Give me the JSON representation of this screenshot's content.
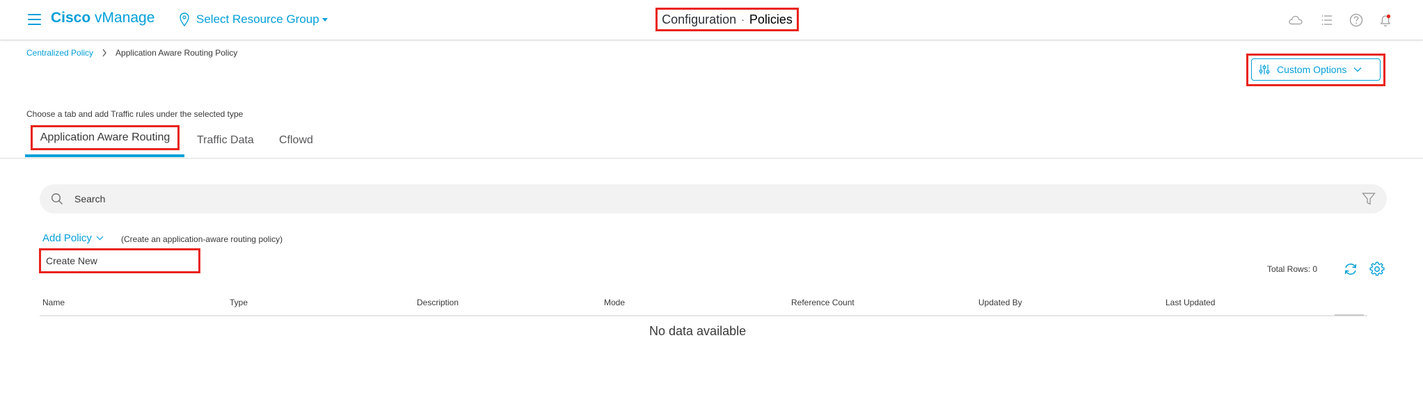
{
  "header": {
    "brand_bold": "Cisco",
    "brand_rest": "vManage",
    "resource_group": "Select Resource Group",
    "title_section": "Configuration",
    "title_separator": "·",
    "title_page": "Policies",
    "icons": [
      "cloud-icon",
      "task-list-icon",
      "help-icon",
      "notification-bell-icon"
    ]
  },
  "breadcrumb": {
    "parent": "Centralized Policy",
    "current": "Application Aware Routing Policy"
  },
  "custom_options": {
    "label": "Custom Options"
  },
  "hint": "Choose a tab and add Traffic rules under the selected type",
  "tabs": [
    {
      "label": "Application Aware Routing",
      "active": true
    },
    {
      "label": "Traffic Data",
      "active": false
    },
    {
      "label": "Cflowd",
      "active": false
    }
  ],
  "search": {
    "placeholder": "Search"
  },
  "add_policy": {
    "label": "Add Policy",
    "description": "(Create an application-aware routing policy)",
    "menu_item": "Create New"
  },
  "table": {
    "total_rows": "Total Rows: 0",
    "columns": [
      "Name",
      "Type",
      "Description",
      "Mode",
      "Reference Count",
      "Updated By",
      "Last Updated"
    ],
    "empty_message": "No data available"
  },
  "colors": {
    "accent": "#049fd9",
    "highlight_box": "#e8241b",
    "text": "#39393b"
  }
}
